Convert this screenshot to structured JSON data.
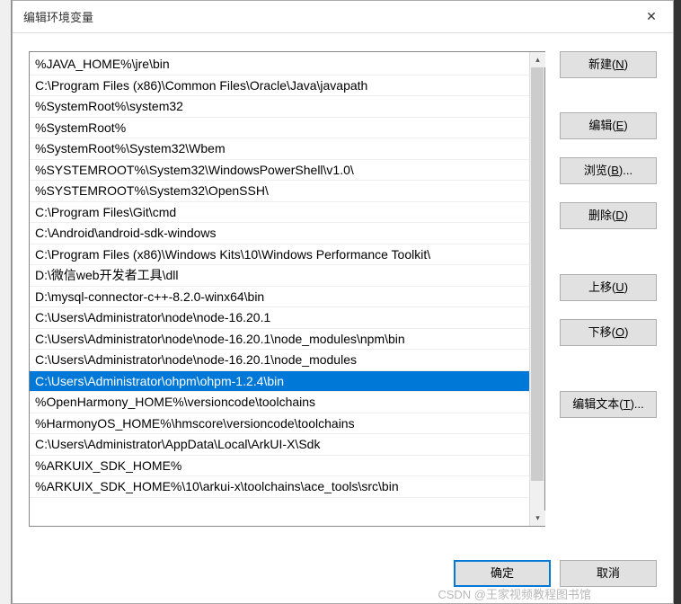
{
  "window": {
    "title": "编辑环境变量"
  },
  "list": {
    "selected_index": 14,
    "items": [
      "%JAVA_HOME%\\jre\\bin",
      "C:\\Program Files (x86)\\Common Files\\Oracle\\Java\\javapath",
      "%SystemRoot%\\system32",
      "%SystemRoot%",
      "%SystemRoot%\\System32\\Wbem",
      "%SYSTEMROOT%\\System32\\WindowsPowerShell\\v1.0\\",
      "%SYSTEMROOT%\\System32\\OpenSSH\\",
      "C:\\Program Files\\Git\\cmd",
      "C:\\Android\\android-sdk-windows",
      "C:\\Program Files (x86)\\Windows Kits\\10\\Windows Performance Toolkit\\",
      "D:\\微信web开发者工具\\dll",
      "D:\\mysql-connector-c++-8.2.0-winx64\\bin",
      "C:\\Users\\Administrator\\node\\node-16.20.1",
      "C:\\Users\\Administrator\\node\\node-16.20.1\\node_modules\\npm\\bin",
      "C:\\Users\\Administrator\\node\\node-16.20.1\\node_modules",
      "C:\\Users\\Administrator\\ohpm\\ohpm-1.2.4\\bin",
      "%OpenHarmony_HOME%\\versioncode\\toolchains",
      "%HarmonyOS_HOME%\\hmscore\\versioncode\\toolchains",
      "C:\\Users\\Administrator\\AppData\\Local\\ArkUI-X\\Sdk",
      "%ARKUIX_SDK_HOME%",
      "%ARKUIX_SDK_HOME%\\10\\arkui-x\\toolchains\\ace_tools\\src\\bin"
    ]
  },
  "side_buttons": {
    "new_label": "新建(",
    "new_accel": "N",
    "new_suffix": ")",
    "edit_label": "编辑(",
    "edit_accel": "E",
    "edit_suffix": ")",
    "browse_label": "浏览(",
    "browse_accel": "B",
    "browse_suffix": ")...",
    "delete_label": "删除(",
    "delete_accel": "D",
    "delete_suffix": ")",
    "moveup_label": "上移(",
    "moveup_accel": "U",
    "moveup_suffix": ")",
    "movedown_label": "下移(",
    "movedown_accel": "O",
    "movedown_suffix": ")",
    "edittext_label": "编辑文本(",
    "edittext_accel": "T",
    "edittext_suffix": ")..."
  },
  "bottom": {
    "ok_label": "确定",
    "cancel_label": "取消"
  },
  "watermark": "CSDN @王家视频教程图书馆"
}
